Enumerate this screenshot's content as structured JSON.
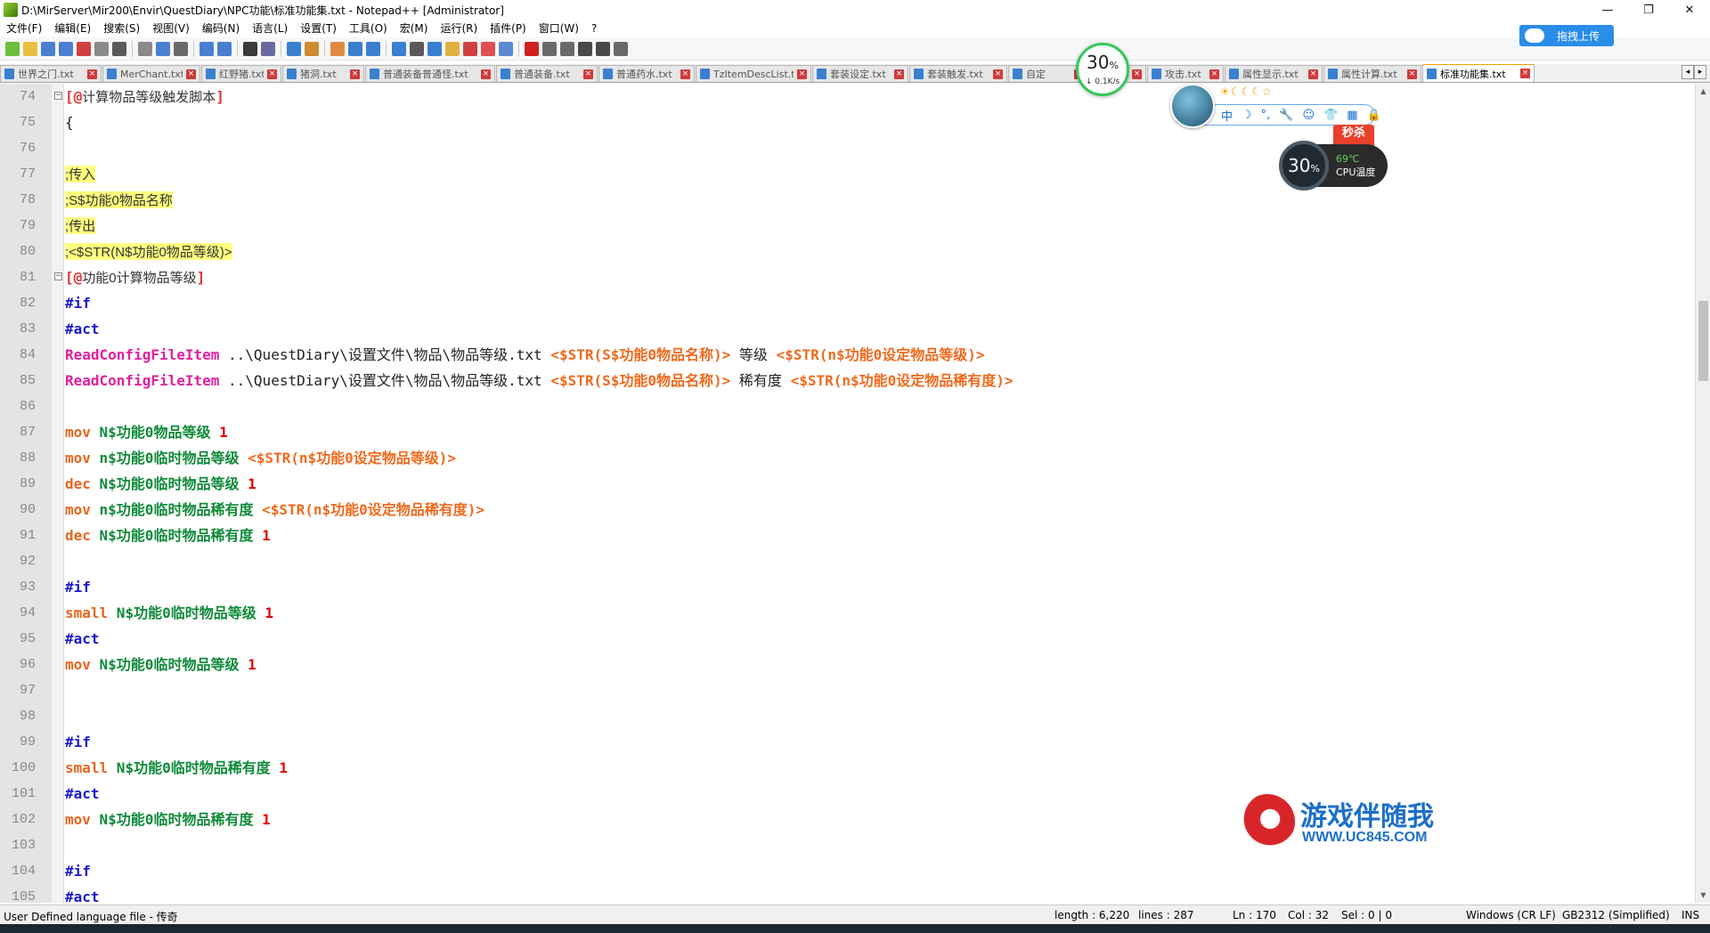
{
  "window": {
    "title": "D:\\MirServer\\Mir200\\Envir\\QuestDiary\\NPC功能\\标准功能集.txt - Notepad++ [Administrator]",
    "minimize": "—",
    "maximize": "❐",
    "close": "✕"
  },
  "menu": [
    "文件(F)",
    "编辑(E)",
    "搜索(S)",
    "视图(V)",
    "编码(N)",
    "语言(L)",
    "设置(T)",
    "工具(O)",
    "宏(M)",
    "运行(R)",
    "插件(P)",
    "窗口(W)",
    "?"
  ],
  "upload_button": "拖拽上传",
  "tabs": [
    {
      "label": "世界之门.txt",
      "active": false
    },
    {
      "label": "MerChant.txt",
      "active": false
    },
    {
      "label": "红野猪.txt",
      "active": false
    },
    {
      "label": "猪洞.txt",
      "active": false
    },
    {
      "label": "普通装备普通怪.txt",
      "active": false
    },
    {
      "label": "普通装备.txt",
      "active": false
    },
    {
      "label": "普通药水.txt",
      "active": false
    },
    {
      "label": "TzItemDescList.txt",
      "active": false
    },
    {
      "label": "套装设定.txt",
      "active": false
    },
    {
      "label": "套装触发.txt",
      "active": false
    },
    {
      "label": "自定",
      "active": false
    },
    {
      "label": "发.txt",
      "active": false
    },
    {
      "label": "攻击.txt",
      "active": false
    },
    {
      "label": "属性显示.txt",
      "active": false
    },
    {
      "label": "属性计算.txt",
      "active": false
    },
    {
      "label": "标准功能集.txt",
      "active": true
    }
  ],
  "tab_scroll": {
    "left": "◂",
    "right": "▸"
  },
  "lines": [
    {
      "n": "74",
      "fold": "−",
      "seg": [
        [
          "k-sect",
          "[@"
        ],
        [
          "k-cmt",
          "计算物品等级触发脚本"
        ],
        [
          "k-sect",
          "]"
        ]
      ]
    },
    {
      "n": "75",
      "seg": [
        [
          "k-plain",
          "{"
        ]
      ]
    },
    {
      "n": "76",
      "seg": []
    },
    {
      "n": "77",
      "hl": true,
      "seg": [
        [
          "k-cmt",
          ";传入"
        ]
      ]
    },
    {
      "n": "78",
      "hl": true,
      "seg": [
        [
          "k-cmt",
          ";S$功能0物品名称"
        ]
      ]
    },
    {
      "n": "79",
      "hl": true,
      "seg": [
        [
          "k-cmt",
          ";传出"
        ]
      ]
    },
    {
      "n": "80",
      "hl": true,
      "seg": [
        [
          "k-cmt",
          ";<$STR(N$功能0物品等级)>"
        ]
      ]
    },
    {
      "n": "81",
      "fold": "−",
      "seg": [
        [
          "k-sect",
          "[@"
        ],
        [
          "k-cmt",
          "功能0计算物品等级"
        ],
        [
          "k-sect",
          "]"
        ]
      ]
    },
    {
      "n": "82",
      "seg": [
        [
          "k-hash",
          "#if"
        ]
      ]
    },
    {
      "n": "83",
      "seg": [
        [
          "k-hash",
          "#act"
        ]
      ]
    },
    {
      "n": "84",
      "seg": [
        [
          "k-cmd-pink",
          "ReadConfigFileItem"
        ],
        [
          "k-plain",
          " ..\\QuestDiary\\设置文件\\物品\\物品等级.txt "
        ],
        [
          "k-str",
          "<$STR(S$功能0物品名称)>"
        ],
        [
          "k-plain",
          " 等级 "
        ],
        [
          "k-str",
          "<$STR(n$功能0设定物品等级)>"
        ]
      ]
    },
    {
      "n": "85",
      "seg": [
        [
          "k-cmd-pink",
          "ReadConfigFileItem"
        ],
        [
          "k-plain",
          " ..\\QuestDiary\\设置文件\\物品\\物品等级.txt "
        ],
        [
          "k-str",
          "<$STR(S$功能0物品名称)>"
        ],
        [
          "k-plain",
          " 稀有度 "
        ],
        [
          "k-str",
          "<$STR(n$功能0设定物品稀有度)>"
        ]
      ]
    },
    {
      "n": "86",
      "seg": []
    },
    {
      "n": "87",
      "seg": [
        [
          "k-cmd-orange",
          "mov"
        ],
        [
          "k-var",
          " N$功能0物品等级 "
        ],
        [
          "k-num",
          "1"
        ]
      ]
    },
    {
      "n": "88",
      "seg": [
        [
          "k-cmd-orange",
          "mov"
        ],
        [
          "k-var",
          " n$功能0临时物品等级 "
        ],
        [
          "k-str",
          "<$STR(n$功能0设定物品等级)>"
        ]
      ]
    },
    {
      "n": "89",
      "seg": [
        [
          "k-cmd-orange",
          "dec"
        ],
        [
          "k-var",
          " N$功能0临时物品等级 "
        ],
        [
          "k-num",
          "1"
        ]
      ]
    },
    {
      "n": "90",
      "seg": [
        [
          "k-cmd-orange",
          "mov"
        ],
        [
          "k-var",
          " n$功能0临时物品稀有度 "
        ],
        [
          "k-str",
          "<$STR(n$功能0设定物品稀有度)>"
        ]
      ]
    },
    {
      "n": "91",
      "seg": [
        [
          "k-cmd-orange",
          "dec"
        ],
        [
          "k-var",
          " N$功能0临时物品稀有度 "
        ],
        [
          "k-num",
          "1"
        ]
      ]
    },
    {
      "n": "92",
      "seg": []
    },
    {
      "n": "93",
      "seg": [
        [
          "k-hash",
          "#if"
        ]
      ]
    },
    {
      "n": "94",
      "seg": [
        [
          "k-cmd-orange",
          "small"
        ],
        [
          "k-var",
          " N$功能0临时物品等级 "
        ],
        [
          "k-num",
          "1"
        ]
      ]
    },
    {
      "n": "95",
      "seg": [
        [
          "k-hash",
          "#act"
        ]
      ]
    },
    {
      "n": "96",
      "seg": [
        [
          "k-cmd-orange",
          "mov"
        ],
        [
          "k-var",
          " N$功能0临时物品等级 "
        ],
        [
          "k-num",
          "1"
        ]
      ]
    },
    {
      "n": "97",
      "seg": []
    },
    {
      "n": "98",
      "seg": []
    },
    {
      "n": "99",
      "seg": [
        [
          "k-hash",
          "#if"
        ]
      ]
    },
    {
      "n": "100",
      "seg": [
        [
          "k-cmd-orange",
          "small"
        ],
        [
          "k-var",
          " N$功能0临时物品稀有度 "
        ],
        [
          "k-num",
          "1"
        ]
      ]
    },
    {
      "n": "101",
      "seg": [
        [
          "k-hash",
          "#act"
        ]
      ]
    },
    {
      "n": "102",
      "seg": [
        [
          "k-cmd-orange",
          "mov"
        ],
        [
          "k-var",
          " N$功能0临时物品稀有度 "
        ],
        [
          "k-num",
          "1"
        ]
      ]
    },
    {
      "n": "103",
      "seg": []
    },
    {
      "n": "104",
      "seg": [
        [
          "k-hash",
          "#if"
        ]
      ]
    },
    {
      "n": "105",
      "seg": [
        [
          "k-hash",
          "#act"
        ]
      ]
    }
  ],
  "status": {
    "language": "User Defined language file - 传奇",
    "length": "length : 6,220",
    "lines": "lines : 287",
    "ln": "Ln : 170",
    "col": "Col : 32",
    "sel": "Sel : 0 | 0",
    "eol": "Windows (CR LF)",
    "encoding": "GB2312 (Simplified)",
    "mode": "INS"
  },
  "net_widget": {
    "percent": "30",
    "unit": "%",
    "speed": "↓ 0.1K/s"
  },
  "ime_bar": {
    "items": [
      "中",
      "☽",
      "°,",
      "🔧",
      "☺",
      "👕",
      "▦",
      "🔒"
    ],
    "stars": "☀☾☾☾☆"
  },
  "miaosha": "秒杀",
  "cpu_widget": {
    "percent": "30",
    "unit": "%",
    "temp": "69℃",
    "label": "CPU温度"
  },
  "watermark": {
    "cn": "游戏伴随我",
    "url": "WWW.UC845.COM"
  },
  "colors": {
    "accent_tab": "#f0a000",
    "highlight": "#ffff80",
    "section": "#e03030",
    "keyword": "#1a1acd"
  }
}
